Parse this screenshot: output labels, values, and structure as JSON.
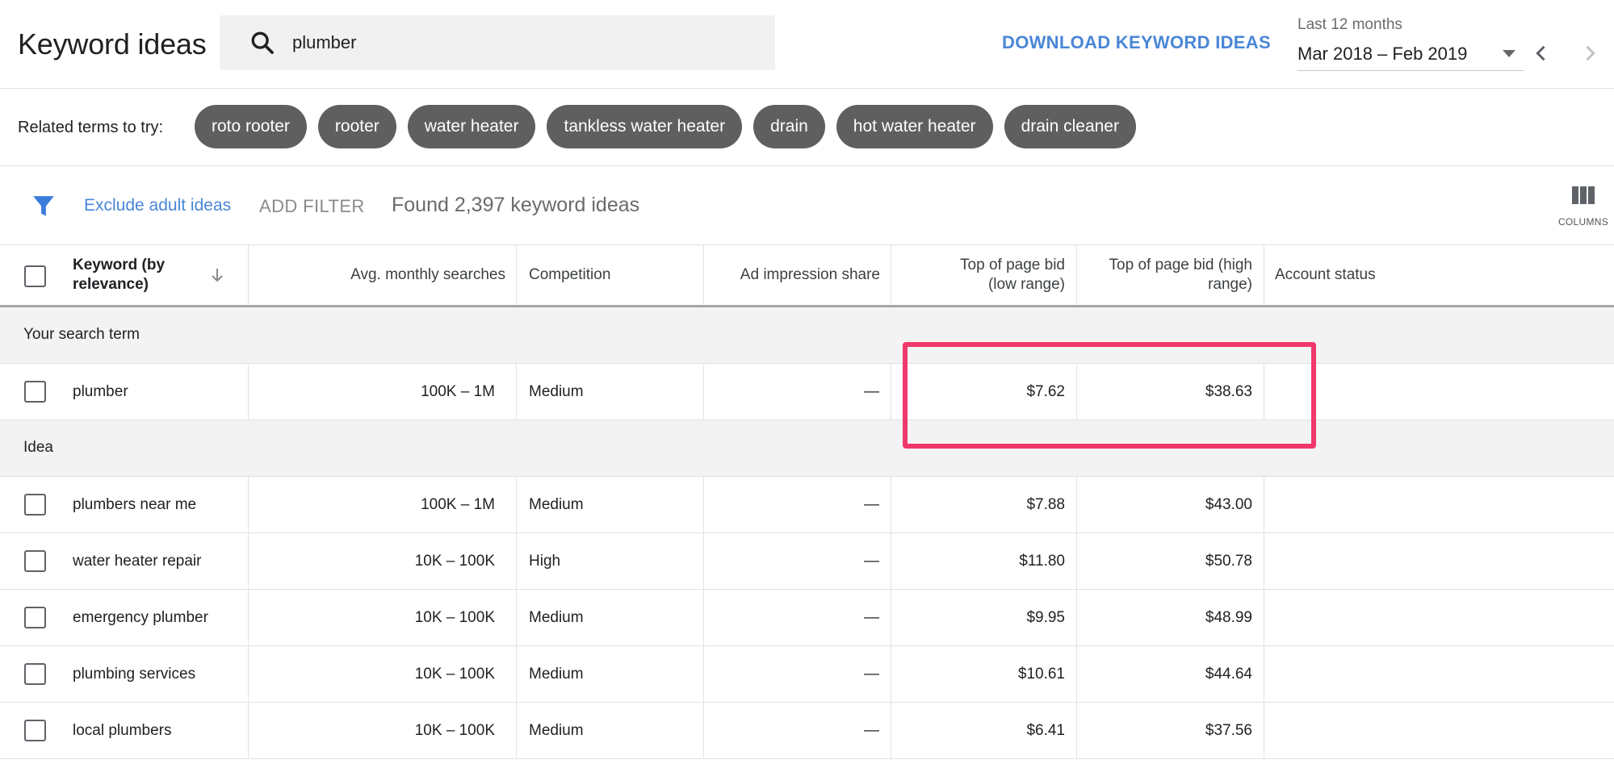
{
  "header": {
    "title": "Keyword ideas",
    "search_value": "plumber",
    "download_label": "DOWNLOAD KEYWORD IDEAS",
    "date_range_label": "Last 12 months",
    "date_range_value": "Mar 2018 – Feb 2019"
  },
  "related": {
    "label": "Related terms to try:",
    "chips": [
      "roto rooter",
      "rooter",
      "water heater",
      "tankless water heater",
      "drain",
      "hot water heater",
      "drain cleaner"
    ]
  },
  "filters": {
    "exclude_label": "Exclude adult ideas",
    "add_filter_label": "ADD FILTER",
    "found_text": "Found 2,397 keyword ideas",
    "columns_label": "COLUMNS"
  },
  "table": {
    "columns": {
      "keyword": "Keyword (by relevance)",
      "avg": "Avg. monthly searches",
      "competition": "Competition",
      "ad_impression": "Ad impression share",
      "bid_low": "Top of page bid (low range)",
      "bid_high": "Top of page bid (high range)",
      "status": "Account status"
    },
    "search_term_group": "Your search term",
    "search_term_rows": [
      {
        "keyword": "plumber",
        "avg": "100K – 1M",
        "competition": "Medium",
        "ad_impression": "—",
        "bid_low": "$7.62",
        "bid_high": "$38.63",
        "status": ""
      }
    ],
    "idea_group": "Idea",
    "idea_rows": [
      {
        "keyword": "plumbers near me",
        "avg": "100K – 1M",
        "competition": "Medium",
        "ad_impression": "—",
        "bid_low": "$7.88",
        "bid_high": "$43.00",
        "status": ""
      },
      {
        "keyword": "water heater repair",
        "avg": "10K – 100K",
        "competition": "High",
        "ad_impression": "—",
        "bid_low": "$11.80",
        "bid_high": "$50.78",
        "status": ""
      },
      {
        "keyword": "emergency plumber",
        "avg": "10K – 100K",
        "competition": "Medium",
        "ad_impression": "—",
        "bid_low": "$9.95",
        "bid_high": "$48.99",
        "status": ""
      },
      {
        "keyword": "plumbing services",
        "avg": "10K – 100K",
        "competition": "Medium",
        "ad_impression": "—",
        "bid_low": "$10.61",
        "bid_high": "$44.64",
        "status": ""
      },
      {
        "keyword": "local plumbers",
        "avg": "10K – 100K",
        "competition": "Medium",
        "ad_impression": "—",
        "bid_low": "$6.41",
        "bid_high": "$37.56",
        "status": ""
      }
    ]
  },
  "colors": {
    "accent_blue": "#4a86d6",
    "chip_bg": "#5f5f5f",
    "highlight_pink": "#f0386b"
  },
  "icons": {
    "search": "search-icon",
    "filter": "filter-icon",
    "columns": "columns-icon",
    "prev": "chevron-left-icon",
    "next": "chevron-right-icon",
    "sort": "arrow-down-icon",
    "dropdown": "caret-down-icon"
  }
}
